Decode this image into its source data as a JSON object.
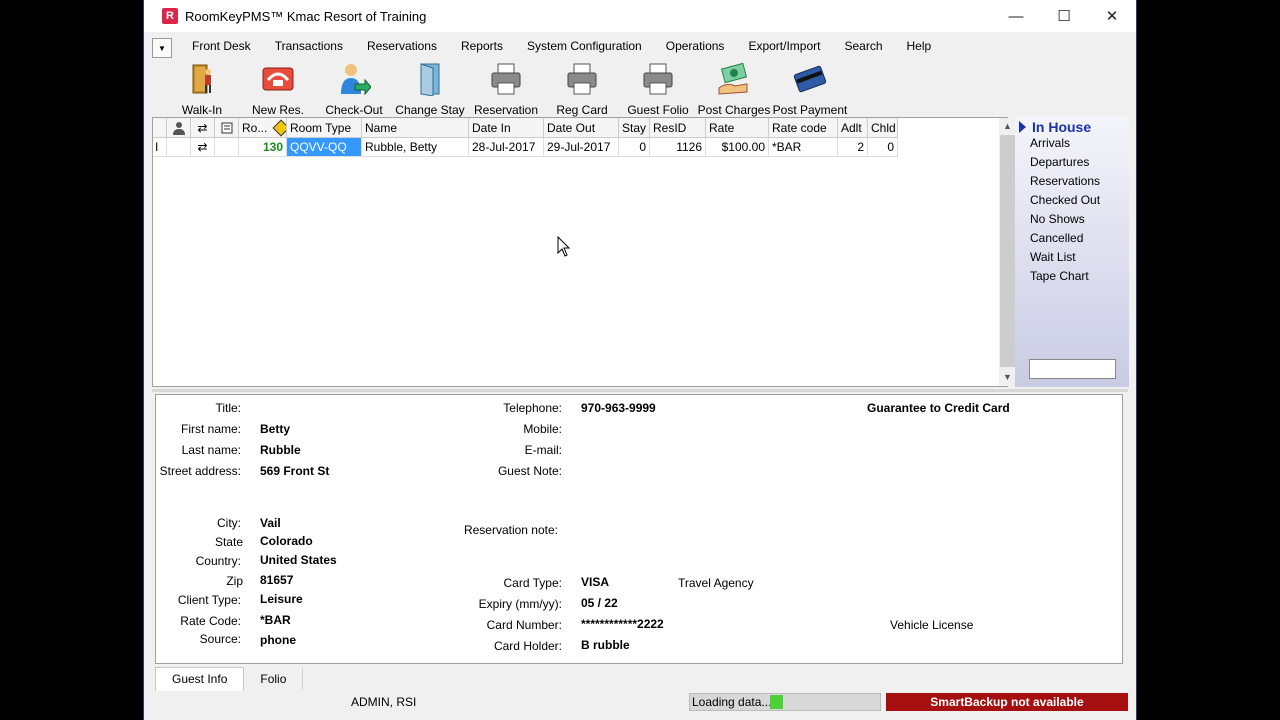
{
  "app": {
    "logo_letter": "R",
    "title": "RoomKeyPMS™  Kmac Resort of Training"
  },
  "window_controls": {
    "minimize": "—",
    "maximize": "☐",
    "close": "✕"
  },
  "menu": {
    "toggle": "▼",
    "items": [
      "Front Desk",
      "Transactions",
      "Reservations",
      "Reports",
      "System Configuration",
      "Operations",
      "Export/Import",
      "Search",
      "Help"
    ]
  },
  "toolbar": {
    "items": [
      {
        "label": "Walk-In",
        "icon": "walk-in-icon"
      },
      {
        "label": "New Res.",
        "icon": "phone-icon"
      },
      {
        "label": "Check-Out",
        "icon": "check-out-icon"
      },
      {
        "label": "Change Stay",
        "icon": "door-icon"
      },
      {
        "label": "Reservation",
        "icon": "printer-icon"
      },
      {
        "label": "Reg Card",
        "icon": "printer-icon"
      },
      {
        "label": "Guest Folio",
        "icon": "printer-icon"
      },
      {
        "label": "Post Charges",
        "icon": "money-hand-icon"
      },
      {
        "label": "Post Payment",
        "icon": "credit-card-icon"
      }
    ]
  },
  "grid": {
    "headers": [
      "",
      "",
      "",
      "",
      "Ro...",
      "Room Type",
      "Name",
      "Date In",
      "Date Out",
      "Stay",
      "ResID",
      "Rate",
      "Rate code",
      "Adlt",
      "Chld"
    ],
    "header_icons": [
      "",
      "guest-icon",
      "refresh-icon",
      "note-icon",
      "status-diamond-icon"
    ],
    "rows": [
      {
        "marker": "I",
        "room": "130",
        "room_type": "QQVV-QQ",
        "name": "Rubble, Betty",
        "date_in": "28-Jul-2017",
        "date_out": "29-Jul-2017",
        "stay": "0",
        "res_id": "1126",
        "rate": "$100.00",
        "rate_code": "*BAR",
        "adults": "2",
        "children": "0"
      }
    ]
  },
  "side_panel": {
    "header": "In House",
    "items": [
      "Arrivals",
      "Departures",
      "Reservations",
      "Checked Out",
      "No Shows",
      "Cancelled",
      "Wait List",
      "Tape Chart"
    ],
    "search_value": ""
  },
  "guest": {
    "labels": {
      "title": "Title:",
      "first_name": "First name:",
      "last_name": "Last name:",
      "street": "Street address:",
      "city": "City:",
      "state": "State",
      "country": "Country:",
      "zip": "Zip",
      "client_type": "Client Type:",
      "rate_code": "Rate Code:",
      "source": "Source:",
      "telephone": "Telephone:",
      "mobile": "Mobile:",
      "email": "E-mail:",
      "guest_note": "Guest Note:",
      "reservation_note": "Reservation note:",
      "card_type": "Card Type:",
      "expiry": "Expiry (mm/yy):",
      "card_number": "Card Number:",
      "card_holder": "Card Holder:",
      "travel_agency": "Travel Agency",
      "vehicle_license": "Vehicle License"
    },
    "values": {
      "title": "",
      "first_name": "Betty",
      "last_name": "Rubble",
      "street": "569 Front St",
      "city": "Vail",
      "state": "Colorado",
      "country": "United States",
      "zip": "81657",
      "client_type": "Leisure",
      "rate_code": "*BAR",
      "source": "phone",
      "telephone": "970-963-9999",
      "card_type": "VISA",
      "expiry": "05 / 22",
      "card_number": "************2222",
      "card_holder": "B rubble",
      "guarantee": "Guarantee to Credit Card"
    }
  },
  "tabs": [
    "Guest Info",
    "Folio"
  ],
  "status": {
    "user": "ADMIN, RSI",
    "loading": "Loading data...",
    "backup": "SmartBackup not available"
  },
  "colors": {
    "accent": "#1a33aa",
    "selection": "#3399ff",
    "room_number": "#1a8a1a",
    "backup_alert": "#a50f0f",
    "progress": "#4cd137"
  }
}
